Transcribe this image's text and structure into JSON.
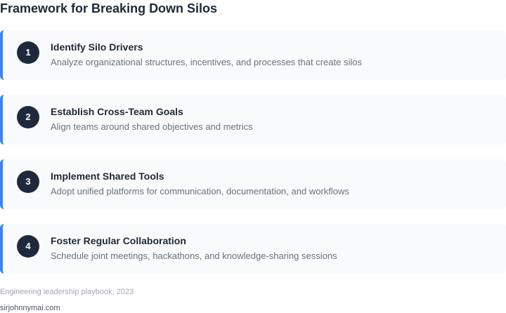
{
  "title": "Framework for Breaking Down Silos",
  "steps": [
    {
      "number": "1",
      "title": "Identify Silo Drivers",
      "description": "Analyze organizational structures, incentives, and processes that create silos"
    },
    {
      "number": "2",
      "title": "Establish Cross-Team Goals",
      "description": "Align teams around shared objectives and metrics"
    },
    {
      "number": "3",
      "title": "Implement Shared Tools",
      "description": "Adopt unified platforms for communication, documentation, and workflows"
    },
    {
      "number": "4",
      "title": "Foster Regular Collaboration",
      "description": "Schedule joint meetings, hackathons, and knowledge-sharing sessions"
    }
  ],
  "footer": {
    "source": "Engineering leadership playbook, 2023",
    "credit": "sirjohnnymai.com"
  },
  "colors": {
    "accent": "#3b82f6",
    "badge": "#1e293b",
    "card_background": "#f8fafc"
  }
}
